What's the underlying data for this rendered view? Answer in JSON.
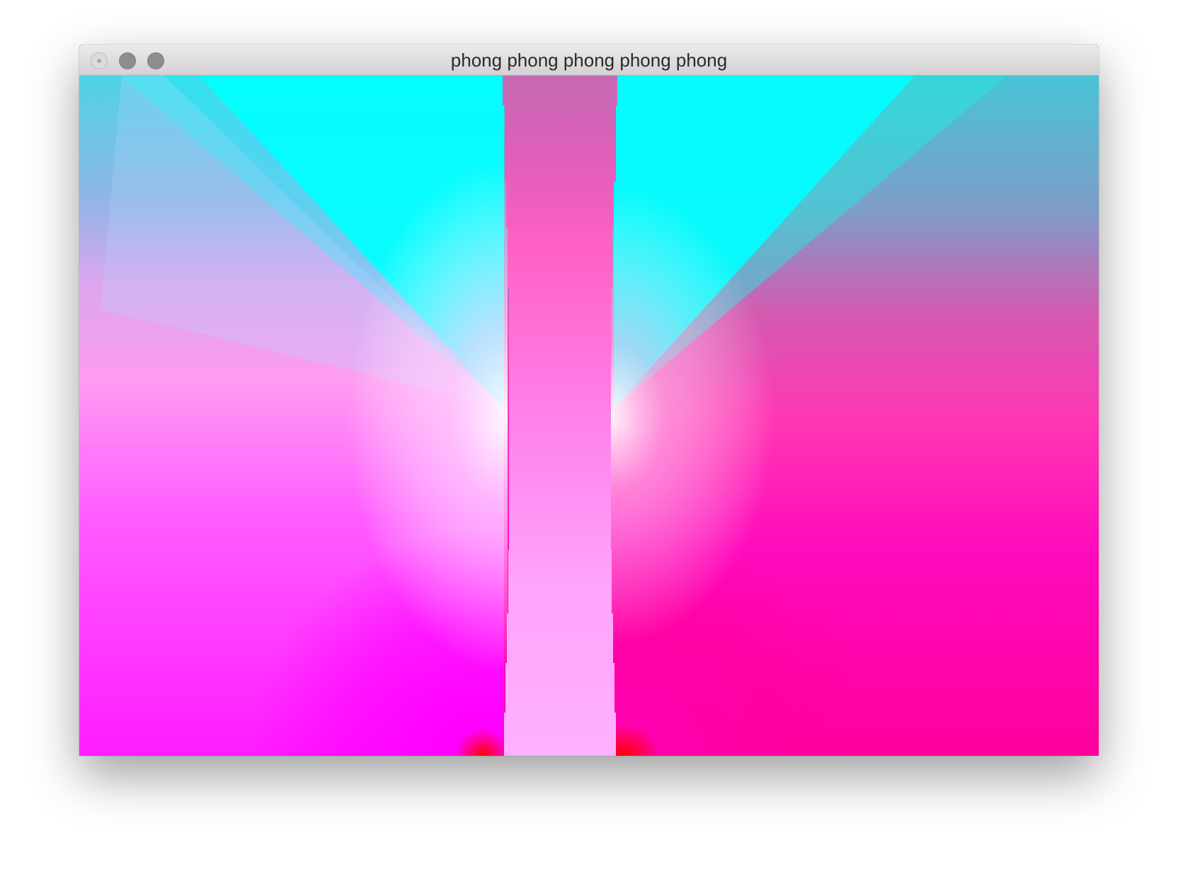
{
  "window": {
    "title": "phong phong phong phong phong"
  },
  "titlebar_buttons": [
    {
      "name": "close",
      "state": "inactive"
    },
    {
      "name": "minimize",
      "state": "inactive"
    },
    {
      "name": "zoom",
      "state": "inactive"
    }
  ],
  "scene": {
    "description_colors": {
      "cyan": "#00ffff",
      "magenta": "#ff00ff",
      "pink": "#ff0090",
      "red": "#ff0000",
      "pillar_top": "#c86bb6",
      "pillar_mid": "#ff5bc0",
      "pillar_bottom": "#ffb0ff"
    }
  }
}
